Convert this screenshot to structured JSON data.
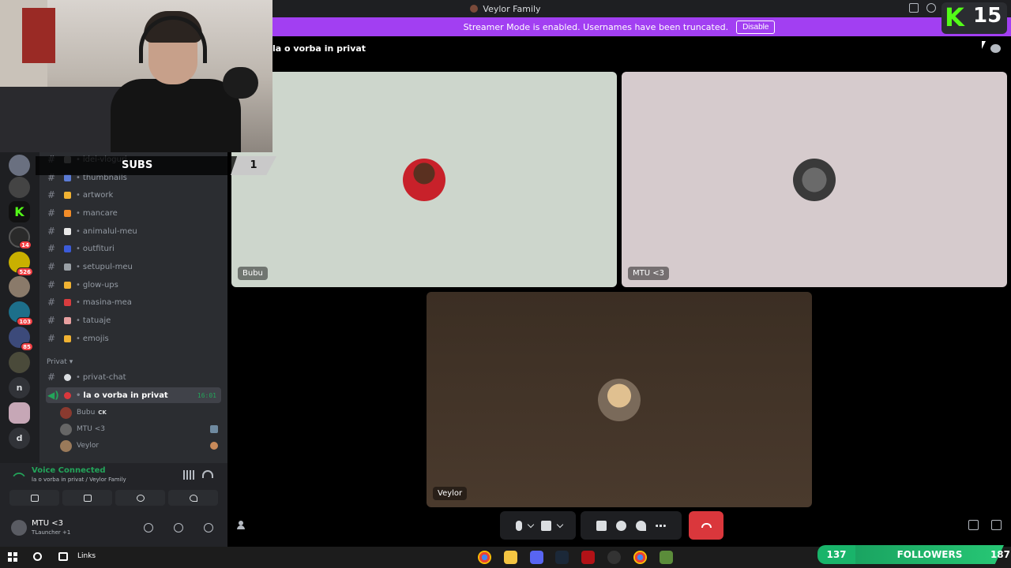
{
  "window": {
    "title": "Veylor Family"
  },
  "banner": {
    "text": "Streamer Mode is enabled. Usernames have been truncated.",
    "button": "Disable"
  },
  "header": {
    "channel_title": "la o vorba in privat"
  },
  "stream_overlay": {
    "subs_label": "SUBS",
    "subs_count": "1",
    "kick_count": "15",
    "followers_label": "FOLLOWERS",
    "followers_count": "137",
    "followers_goal": "187"
  },
  "servers": [
    {
      "badge": ""
    },
    {
      "badge": ""
    },
    {
      "badge": ""
    },
    {
      "badge": "14"
    },
    {
      "badge": "526"
    },
    {
      "badge": ""
    },
    {
      "badge": "103"
    },
    {
      "badge": "85"
    },
    {
      "badge": ""
    },
    {
      "letter": "n"
    },
    {
      "badge": ""
    },
    {
      "letter": "d"
    }
  ],
  "channels": [
    {
      "name": "idei-vloguri",
      "color": "#8e9297"
    },
    {
      "name": "thumbnails",
      "color": "#5b7bd5"
    },
    {
      "name": "artwork",
      "color": "#f0b232"
    },
    {
      "name": "mancare",
      "color": "#f28c28"
    },
    {
      "name": "animalul-meu",
      "color": "#e8e8e8"
    },
    {
      "name": "outfituri",
      "color": "#3b5bd9"
    },
    {
      "name": "setupul-meu",
      "color": "#9aa0a6"
    },
    {
      "name": "glow-ups",
      "color": "#f0b232"
    },
    {
      "name": "masina-mea",
      "color": "#d83c3e"
    },
    {
      "name": "tatuaje",
      "color": "#e8a0a0"
    },
    {
      "name": "emojis",
      "color": "#f0b232"
    }
  ],
  "category": {
    "name": "Privat"
  },
  "private_channels": [
    {
      "name": "privat-chat"
    },
    {
      "name": "la o vorba in privat",
      "time": "16:01"
    }
  ],
  "voice_users": [
    {
      "name": "Bubu",
      "tag": "CK",
      "color": "#8a3a2f"
    },
    {
      "name": "MTU <3",
      "tag": "",
      "color": "#666666"
    },
    {
      "name": "Veylor",
      "tag": "",
      "color": "#9a7a5a"
    }
  ],
  "voice_panel": {
    "status": "Voice Connected",
    "location": "la o vorba in privat / Veylor Family"
  },
  "user": {
    "name": "MTU <3",
    "status": "TLauncher +1"
  },
  "tiles": [
    {
      "name": "Bubu",
      "bg": "#cdd6cc"
    },
    {
      "name": "MTU <3",
      "bg": "#d6cbcd"
    },
    {
      "name": "Veylor",
      "bg": "#3b2e23"
    }
  ],
  "taskbar": {
    "links": "Links"
  },
  "colors": {
    "accent_green": "#23a55a",
    "banner_purple": "#a23ff2",
    "end_call_red": "#da373c",
    "kick_green": "#53fc18"
  }
}
